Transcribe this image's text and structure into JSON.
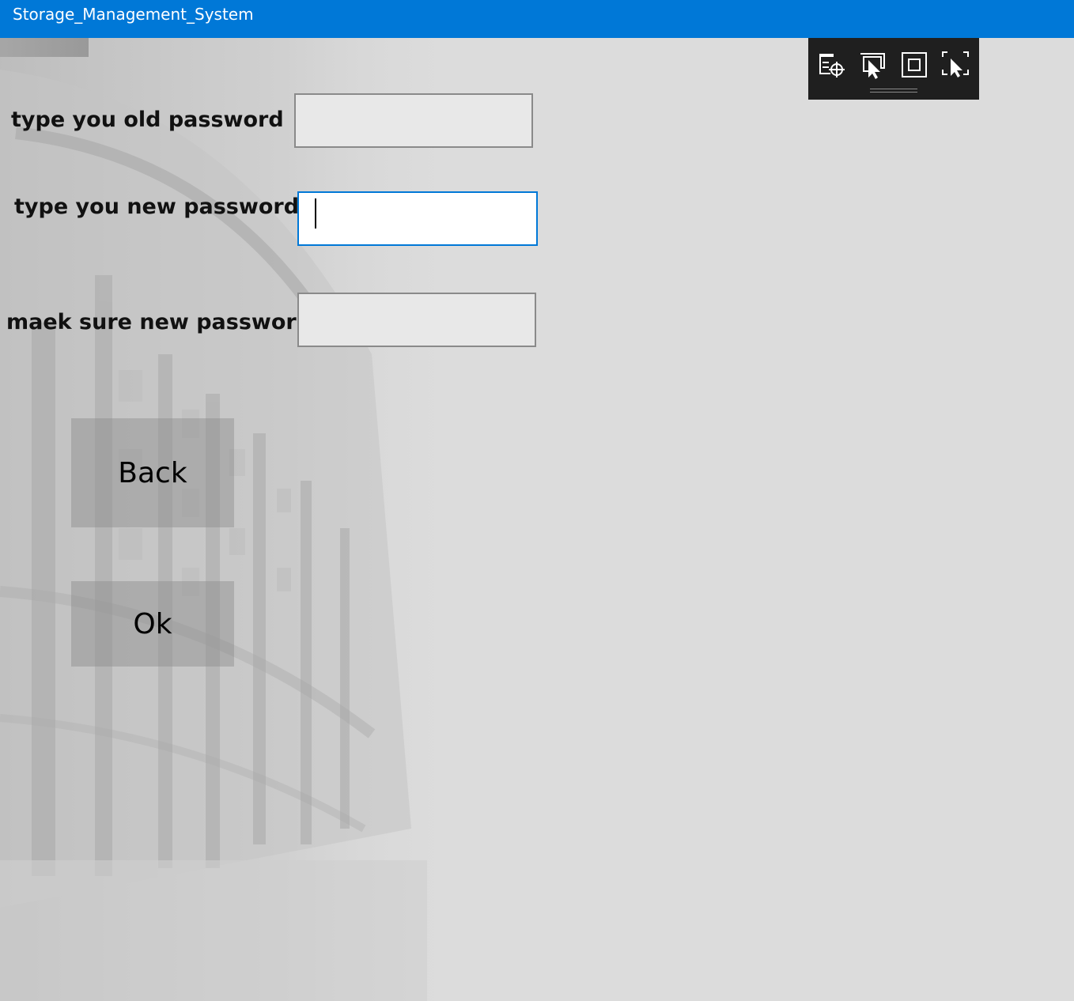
{
  "window": {
    "title": "Storage_Management_System",
    "accent_color": "#0078d7"
  },
  "form": {
    "old_password_label": "type you old password",
    "old_password_value": "",
    "new_password_label": "type you new password",
    "new_password_value": "",
    "confirm_password_label": "maek sure new password",
    "confirm_password_value": ""
  },
  "buttons": {
    "back_label": "Back",
    "ok_label": "Ok"
  },
  "debug_toolbar": {
    "icons": [
      "live-visual-tree-icon",
      "select-element-icon",
      "display-layout-adorners-icon",
      "track-focused-element-icon"
    ]
  }
}
